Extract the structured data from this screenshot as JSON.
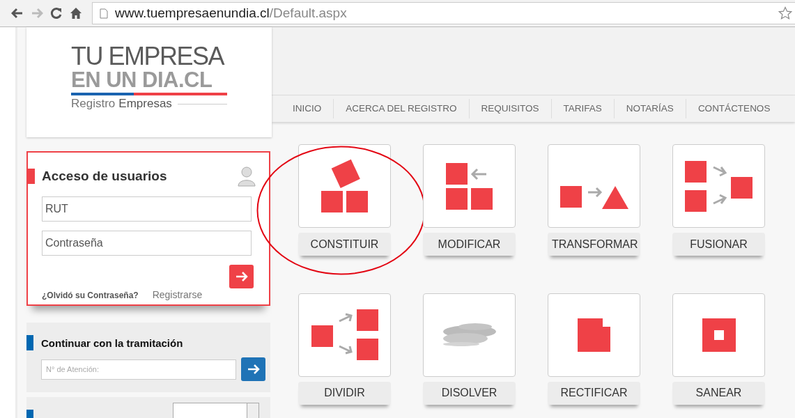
{
  "browser": {
    "url_host": "www.tuempresaenundia.cl",
    "url_path": "/Default.aspx"
  },
  "logo": {
    "line1": "TU EMPRESA",
    "line2": "EN UN DIA.CL",
    "tagline_light": "Registro",
    "tagline_bold": "Empresas"
  },
  "nav": [
    "INICIO",
    "ACERCA DEL REGISTRO",
    "REQUISITOS",
    "TARIFAS",
    "NOTARÍAS",
    "CONTÁCTENOS"
  ],
  "login": {
    "title": "Acceso de usuarios",
    "rut": {
      "placeholder": "RUT"
    },
    "password": {
      "placeholder": "Contraseña"
    },
    "forgot": "¿Olvidó su Contraseña?",
    "register": "Registrarse"
  },
  "continue": {
    "title": "Continuar con la tramitación",
    "field": {
      "placeholder": "N° de Atención:"
    }
  },
  "tiles": [
    {
      "label": "CONSTITUIR",
      "kind": "constituir",
      "highlighted": true
    },
    {
      "label": "MODIFICAR",
      "kind": "modificar",
      "highlighted": false
    },
    {
      "label": "TRANSFORMAR",
      "kind": "transformar",
      "highlighted": false
    },
    {
      "label": "FUSIONAR",
      "kind": "fusionar",
      "highlighted": false
    },
    {
      "label": "DIVIDIR",
      "kind": "dividir",
      "highlighted": false
    },
    {
      "label": "DISOLVER",
      "kind": "disolver",
      "highlighted": false
    },
    {
      "label": "RECTIFICAR",
      "kind": "rectificar",
      "highlighted": false
    },
    {
      "label": "SANEAR",
      "kind": "sanear",
      "highlighted": false
    }
  ]
}
